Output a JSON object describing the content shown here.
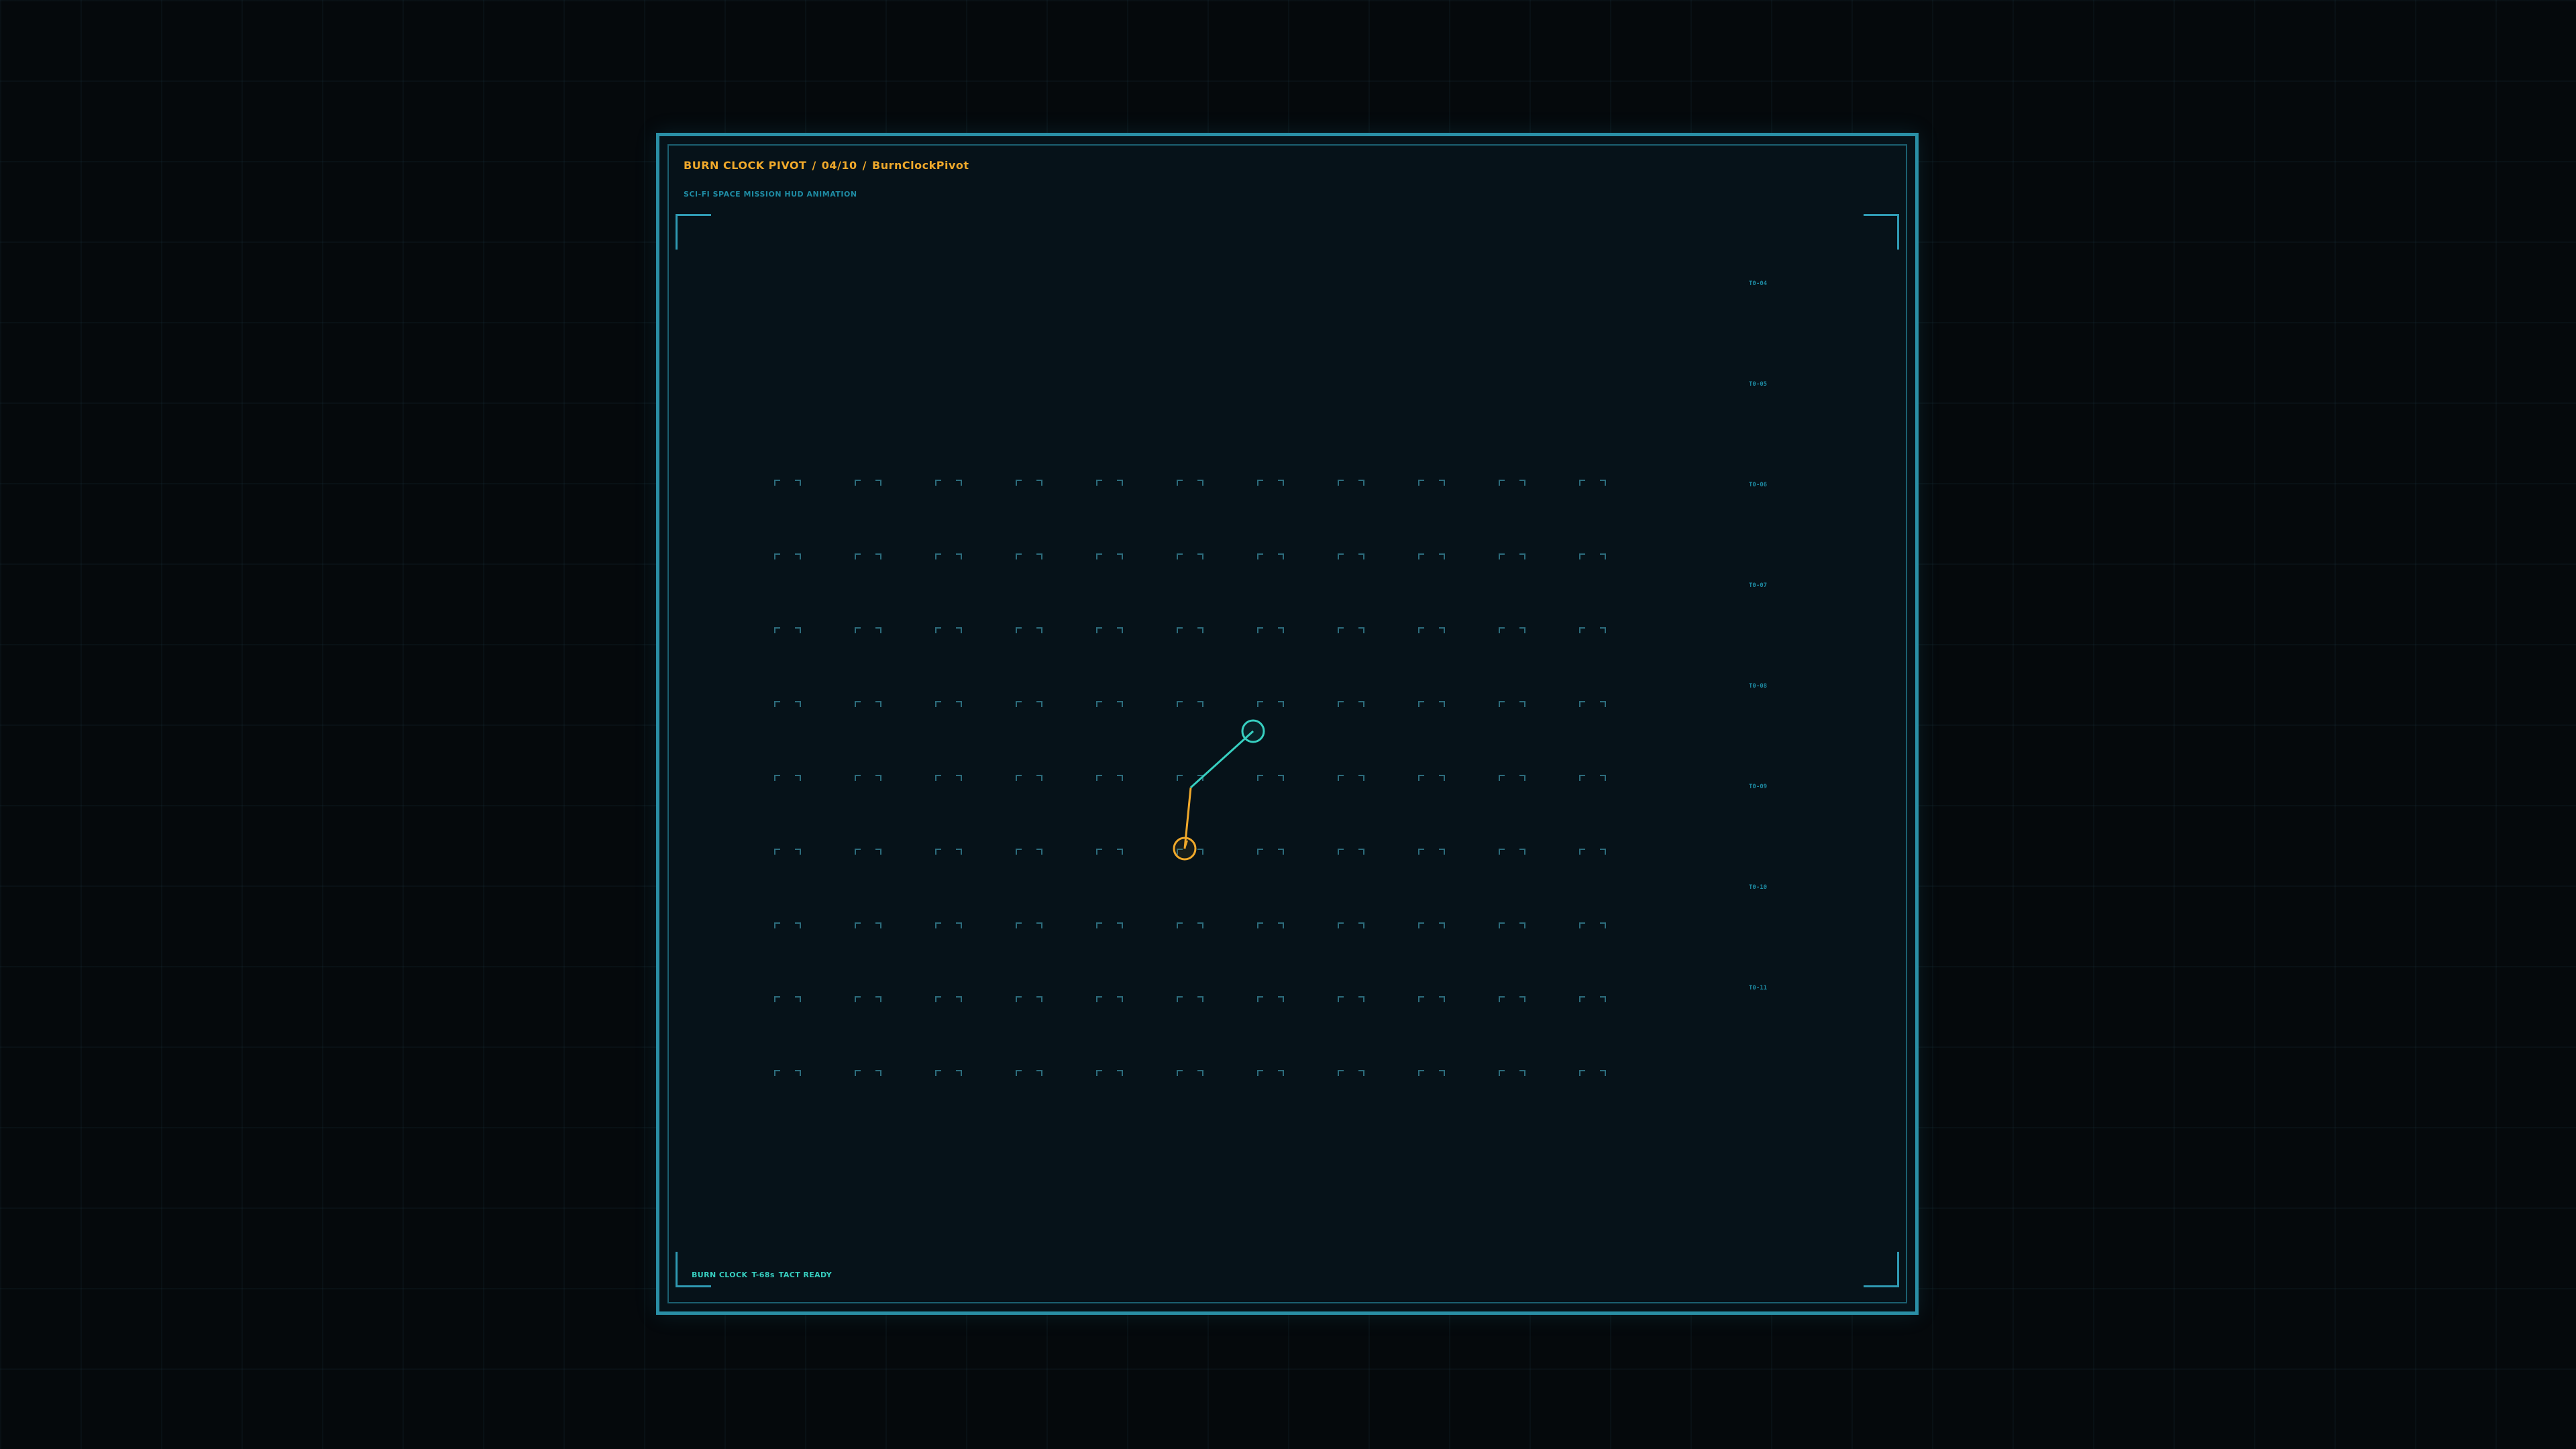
{
  "header": {
    "title_part1": "BURN CLOCK PIVOT",
    "separator": "/",
    "frame_counter": "04/10",
    "title_part3": "BurnClockPivot",
    "subtitle": "SCI-FI SPACE MISSION HUD ANIMATION"
  },
  "scale_ticks": [
    "T0-04",
    "T0-05",
    "T0-06",
    "T0-07",
    "T0-08",
    "T0-09",
    "T0-10",
    "T0-11"
  ],
  "status": {
    "label": "BURN CLOCK",
    "countdown": "T-68s",
    "state": "TACT READY"
  },
  "colors": {
    "accent_amber": "#f0a92b",
    "accent_teal": "#37cfc0",
    "frame_blue": "#2a8fa6",
    "grid_marker": "#2c6c7c"
  },
  "grid": {
    "columns": 11,
    "rows": 9
  },
  "pivot": {
    "amber_node_icon": "amber-ring-icon",
    "teal_node_icon": "teal-ring-icon"
  }
}
